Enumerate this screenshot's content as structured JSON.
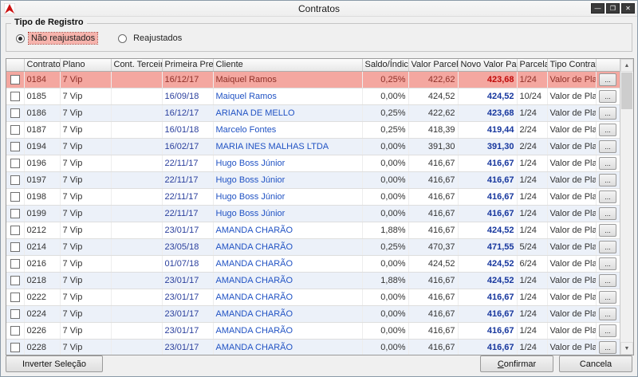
{
  "window": {
    "title": "Contratos",
    "controls": {
      "minimize": "—",
      "maximize": "❐",
      "close": "✕"
    }
  },
  "filter": {
    "group_title": "Tipo de Registro",
    "options": [
      {
        "label": "Não reajustados",
        "selected": true
      },
      {
        "label": "Reajustados",
        "selected": false
      }
    ]
  },
  "table": {
    "columns": [
      "Contrato",
      "Plano",
      "Cont. Terceiro",
      "Primeira Prev.",
      "Cliente",
      "Saldo/Índice",
      "Valor Parcela",
      "Novo Valor Parcela",
      "Parcelas",
      "Tipo Contrato"
    ],
    "row_action_label": "...",
    "rows": [
      {
        "contrato": "0184",
        "plano": "7 Vip",
        "cont_terceiro": "",
        "primeira_prev": "16/12/17",
        "cliente": "Maiquel Ramos",
        "saldo_indice": "0,25%",
        "valor_parcela": "422,62",
        "novo_valor_parcela": "423,68",
        "parcelas": "1/24",
        "tipo_contrato": "Valor de Plano",
        "selected": true
      },
      {
        "contrato": "0185",
        "plano": "7 Vip",
        "cont_terceiro": "",
        "primeira_prev": "16/09/18",
        "cliente": "Maiquel Ramos",
        "saldo_indice": "0,00%",
        "valor_parcela": "424,52",
        "novo_valor_parcela": "424,52",
        "parcelas": "10/24",
        "tipo_contrato": "Valor de Plano",
        "selected": false
      },
      {
        "contrato": "0186",
        "plano": "7 Vip",
        "cont_terceiro": "",
        "primeira_prev": "16/12/17",
        "cliente": "ARIANA DE MELLO",
        "saldo_indice": "0,25%",
        "valor_parcela": "422,62",
        "novo_valor_parcela": "423,68",
        "parcelas": "1/24",
        "tipo_contrato": "Valor de Plano",
        "selected": false
      },
      {
        "contrato": "0187",
        "plano": "7 Vip",
        "cont_terceiro": "",
        "primeira_prev": "16/01/18",
        "cliente": "Marcelo Fontes",
        "saldo_indice": "0,25%",
        "valor_parcela": "418,39",
        "novo_valor_parcela": "419,44",
        "parcelas": "2/24",
        "tipo_contrato": "Valor de Plano",
        "selected": false
      },
      {
        "contrato": "0194",
        "plano": "7 Vip",
        "cont_terceiro": "",
        "primeira_prev": "16/02/17",
        "cliente": "MARIA INES MALHAS LTDA",
        "saldo_indice": "0,00%",
        "valor_parcela": "391,30",
        "novo_valor_parcela": "391,30",
        "parcelas": "2/24",
        "tipo_contrato": "Valor de Plano",
        "selected": false
      },
      {
        "contrato": "0196",
        "plano": "7 Vip",
        "cont_terceiro": "",
        "primeira_prev": "22/11/17",
        "cliente": "Hugo Boss Júnior",
        "saldo_indice": "0,00%",
        "valor_parcela": "416,67",
        "novo_valor_parcela": "416,67",
        "parcelas": "1/24",
        "tipo_contrato": "Valor de Plano",
        "selected": false
      },
      {
        "contrato": "0197",
        "plano": "7 Vip",
        "cont_terceiro": "",
        "primeira_prev": "22/11/17",
        "cliente": "Hugo Boss Júnior",
        "saldo_indice": "0,00%",
        "valor_parcela": "416,67",
        "novo_valor_parcela": "416,67",
        "parcelas": "1/24",
        "tipo_contrato": "Valor de Plano",
        "selected": false
      },
      {
        "contrato": "0198",
        "plano": "7 Vip",
        "cont_terceiro": "",
        "primeira_prev": "22/11/17",
        "cliente": "Hugo Boss Júnior",
        "saldo_indice": "0,00%",
        "valor_parcela": "416,67",
        "novo_valor_parcela": "416,67",
        "parcelas": "1/24",
        "tipo_contrato": "Valor de Plano",
        "selected": false
      },
      {
        "contrato": "0199",
        "plano": "7 Vip",
        "cont_terceiro": "",
        "primeira_prev": "22/11/17",
        "cliente": "Hugo Boss Júnior",
        "saldo_indice": "0,00%",
        "valor_parcela": "416,67",
        "novo_valor_parcela": "416,67",
        "parcelas": "1/24",
        "tipo_contrato": "Valor de Plano",
        "selected": false
      },
      {
        "contrato": "0212",
        "plano": "7 Vip",
        "cont_terceiro": "",
        "primeira_prev": "23/01/17",
        "cliente": "AMANDA CHARÃO",
        "saldo_indice": "1,88%",
        "valor_parcela": "416,67",
        "novo_valor_parcela": "424,52",
        "parcelas": "1/24",
        "tipo_contrato": "Valor de Plano",
        "selected": false
      },
      {
        "contrato": "0214",
        "plano": "7 Vip",
        "cont_terceiro": "",
        "primeira_prev": "23/05/18",
        "cliente": "AMANDA CHARÃO",
        "saldo_indice": "0,25%",
        "valor_parcela": "470,37",
        "novo_valor_parcela": "471,55",
        "parcelas": "5/24",
        "tipo_contrato": "Valor de Plano",
        "selected": false
      },
      {
        "contrato": "0216",
        "plano": "7 Vip",
        "cont_terceiro": "",
        "primeira_prev": "01/07/18",
        "cliente": "AMANDA CHARÃO",
        "saldo_indice": "0,00%",
        "valor_parcela": "424,52",
        "novo_valor_parcela": "424,52",
        "parcelas": "6/24",
        "tipo_contrato": "Valor de Plano",
        "selected": false
      },
      {
        "contrato": "0218",
        "plano": "7 Vip",
        "cont_terceiro": "",
        "primeira_prev": "23/01/17",
        "cliente": "AMANDA CHARÃO",
        "saldo_indice": "1,88%",
        "valor_parcela": "416,67",
        "novo_valor_parcela": "424,52",
        "parcelas": "1/24",
        "tipo_contrato": "Valor de Plano",
        "selected": false
      },
      {
        "contrato": "0222",
        "plano": "7 Vip",
        "cont_terceiro": "",
        "primeira_prev": "23/01/17",
        "cliente": "AMANDA CHARÃO",
        "saldo_indice": "0,00%",
        "valor_parcela": "416,67",
        "novo_valor_parcela": "416,67",
        "parcelas": "1/24",
        "tipo_contrato": "Valor de Plano",
        "selected": false
      },
      {
        "contrato": "0224",
        "plano": "7 Vip",
        "cont_terceiro": "",
        "primeira_prev": "23/01/17",
        "cliente": "AMANDA CHARÃO",
        "saldo_indice": "0,00%",
        "valor_parcela": "416,67",
        "novo_valor_parcela": "416,67",
        "parcelas": "1/24",
        "tipo_contrato": "Valor de Plano",
        "selected": false
      },
      {
        "contrato": "0226",
        "plano": "7 Vip",
        "cont_terceiro": "",
        "primeira_prev": "23/01/17",
        "cliente": "AMANDA CHARÃO",
        "saldo_indice": "0,00%",
        "valor_parcela": "416,67",
        "novo_valor_parcela": "416,67",
        "parcelas": "1/24",
        "tipo_contrato": "Valor de Plano",
        "selected": false
      },
      {
        "contrato": "0228",
        "plano": "7 Vip",
        "cont_terceiro": "",
        "primeira_prev": "23/01/17",
        "cliente": "AMANDA CHARÃO",
        "saldo_indice": "0,00%",
        "valor_parcela": "416,67",
        "novo_valor_parcela": "416,67",
        "parcelas": "1/24",
        "tipo_contrato": "Valor de Plano",
        "selected": false
      }
    ]
  },
  "scrollbar": {
    "up": "▲",
    "down": "▼"
  },
  "footer": {
    "invert_button": "Inverter Seleção",
    "confirm_button": "Confirmar",
    "cancel_button": "Cancela"
  },
  "colors": {
    "selected_row_bg": "#f4a7a0",
    "selected_row_text": "#8f3028",
    "selected_value_text": "#c00a0a",
    "alt_row_bg": "#ecf1f9",
    "client_text": "#2153c4",
    "date_text": "#2a3f9d",
    "new_value_text": "#17379e",
    "radio_highlight_bg": "#f6b3ac"
  }
}
